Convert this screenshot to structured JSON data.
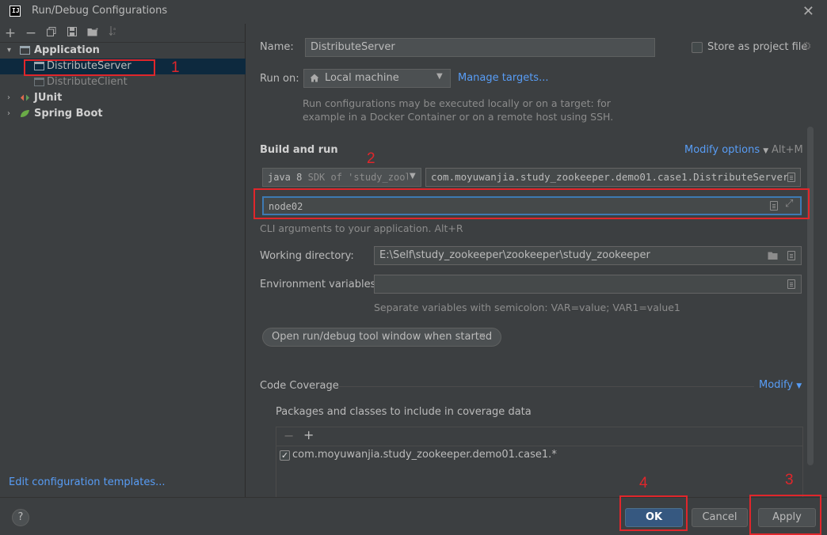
{
  "window": {
    "title": "Run/Debug Configurations",
    "logo": "IJ",
    "close_icon": "close-icon"
  },
  "toolbar": {
    "add": "+",
    "remove": "−",
    "copy": "copy-icon",
    "save": "save-icon",
    "new_folder": "folder-icon",
    "sort": "sort-icon"
  },
  "tree": {
    "items": [
      {
        "label": "Application",
        "expanded": true
      },
      {
        "label": "DistributeServer",
        "selected": true
      },
      {
        "label": "DistributeClient"
      },
      {
        "label": "JUnit",
        "expanded": false
      },
      {
        "label": "Spring Boot",
        "expanded": false
      }
    ]
  },
  "edit_templates_label": "Edit configuration templates...",
  "name": {
    "label": "Name:",
    "value": "DistributeServer"
  },
  "store_project_file": {
    "label": "Store as project file",
    "checked": false
  },
  "run_on": {
    "label": "Run on:",
    "value": "Local machine",
    "manage_targets": "Manage targets...",
    "hint": "Run configurations may be executed locally or on a target: for\nexample in a Docker Container or on a remote host using SSH."
  },
  "build_and_run": {
    "heading": "Build and run",
    "modify_options": "Modify options",
    "modify_shortcut": "Alt+M",
    "sdk_value": "java 8",
    "sdk_detail": "SDK of 'study_zool",
    "main_class": "com.moyuwanjia.study_zookeeper.demo01.case1.DistributeServer",
    "program_args": "node02",
    "program_args_hint": "CLI arguments to your application. Alt+R"
  },
  "working_directory": {
    "label": "Working directory:",
    "value": "E:\\Self\\study_zookeeper\\zookeeper\\study_zookeeper"
  },
  "environment_variables": {
    "label": "Environment variables:",
    "value": "",
    "hint": "Separate variables with semicolon: VAR=value; VAR1=value1"
  },
  "open_tool_window_chip": "Open run/debug tool window when started",
  "code_coverage": {
    "heading": "Code Coverage",
    "modify": "Modify",
    "packages_label": "Packages and classes to include in coverage data",
    "entries": [
      {
        "checked": true,
        "label": "com.moyuwanjia.study_zookeeper.demo01.case1.*"
      }
    ]
  },
  "annotations": {
    "n1": "1",
    "n2": "2",
    "n3": "3",
    "n4": "4",
    "color": "#e0262b"
  },
  "buttons": {
    "help": "?",
    "ok": "OK",
    "cancel": "Cancel",
    "apply": "Apply"
  },
  "colors": {
    "background": "#3c3f41",
    "selection": "#0d293e",
    "link": "#589df6",
    "primary_button": "#365880",
    "focus_border": "#3d7ab3"
  }
}
